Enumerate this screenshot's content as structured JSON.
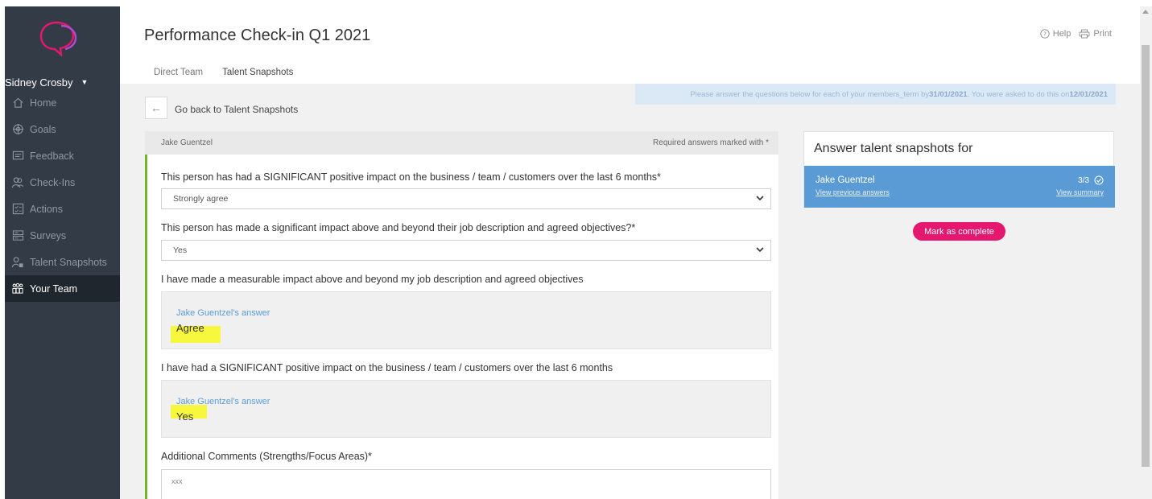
{
  "app": {
    "page_title": "Performance Check-in Q1 2021",
    "help_label": "Help",
    "print_label": "Print",
    "brand_color": "#e6176f"
  },
  "sidebar": {
    "user_name": "Sidney Crosby",
    "items": [
      {
        "label": "Home",
        "icon": "home-icon"
      },
      {
        "label": "Goals",
        "icon": "target-icon"
      },
      {
        "label": "Feedback",
        "icon": "feedback-icon"
      },
      {
        "label": "Check-Ins",
        "icon": "people-icon"
      },
      {
        "label": "Actions",
        "icon": "checklist-icon"
      },
      {
        "label": "Surveys",
        "icon": "survey-icon"
      },
      {
        "label": "Talent Snapshots",
        "icon": "talent-icon"
      },
      {
        "label": "Your Team",
        "icon": "team-icon",
        "active": true
      }
    ]
  },
  "tabs": [
    {
      "label": "Direct Team"
    },
    {
      "label": "Talent Snapshots",
      "active": true
    }
  ],
  "back": {
    "label": "Go back to Talent Snapshots"
  },
  "notice": {
    "text_before": "Please answer the questions below for each of your members_term by ",
    "due_date": "31/01/2021",
    "text_middle": ". You were asked to do this on ",
    "asked_date": "12/01/2021"
  },
  "form": {
    "person": "Jake Guentzel",
    "required_note": "Required answers marked with *",
    "q1": {
      "question": "This person has had a SIGNIFICANT positive impact on the business / team / customers over the last 6 months*",
      "value": "Strongly agree"
    },
    "q2": {
      "question": "This person has made a significant impact above and beyond their job description and agreed objectives?*",
      "value": "Yes"
    },
    "q3": {
      "question": "I have made a measurable impact above and beyond my job description and agreed objectives",
      "answer_label": "Jake Guentzel's answer",
      "answer": "Agree"
    },
    "q4": {
      "question": "I have had a SIGNIFICANT positive impact on the business / team / customers over the last 6 months",
      "answer_label": "Jake Guentzel's answer",
      "answer": "Yes"
    },
    "q5": {
      "question": "Additional Comments (Strengths/Focus Areas)*",
      "value": "xxx"
    }
  },
  "side": {
    "title": "Answer talent snapshots for",
    "person": "Jake Guentzel",
    "count": "3/3",
    "view_previous": "View previous answers",
    "view_summary": "View summary",
    "complete_label": "Mark as complete"
  }
}
